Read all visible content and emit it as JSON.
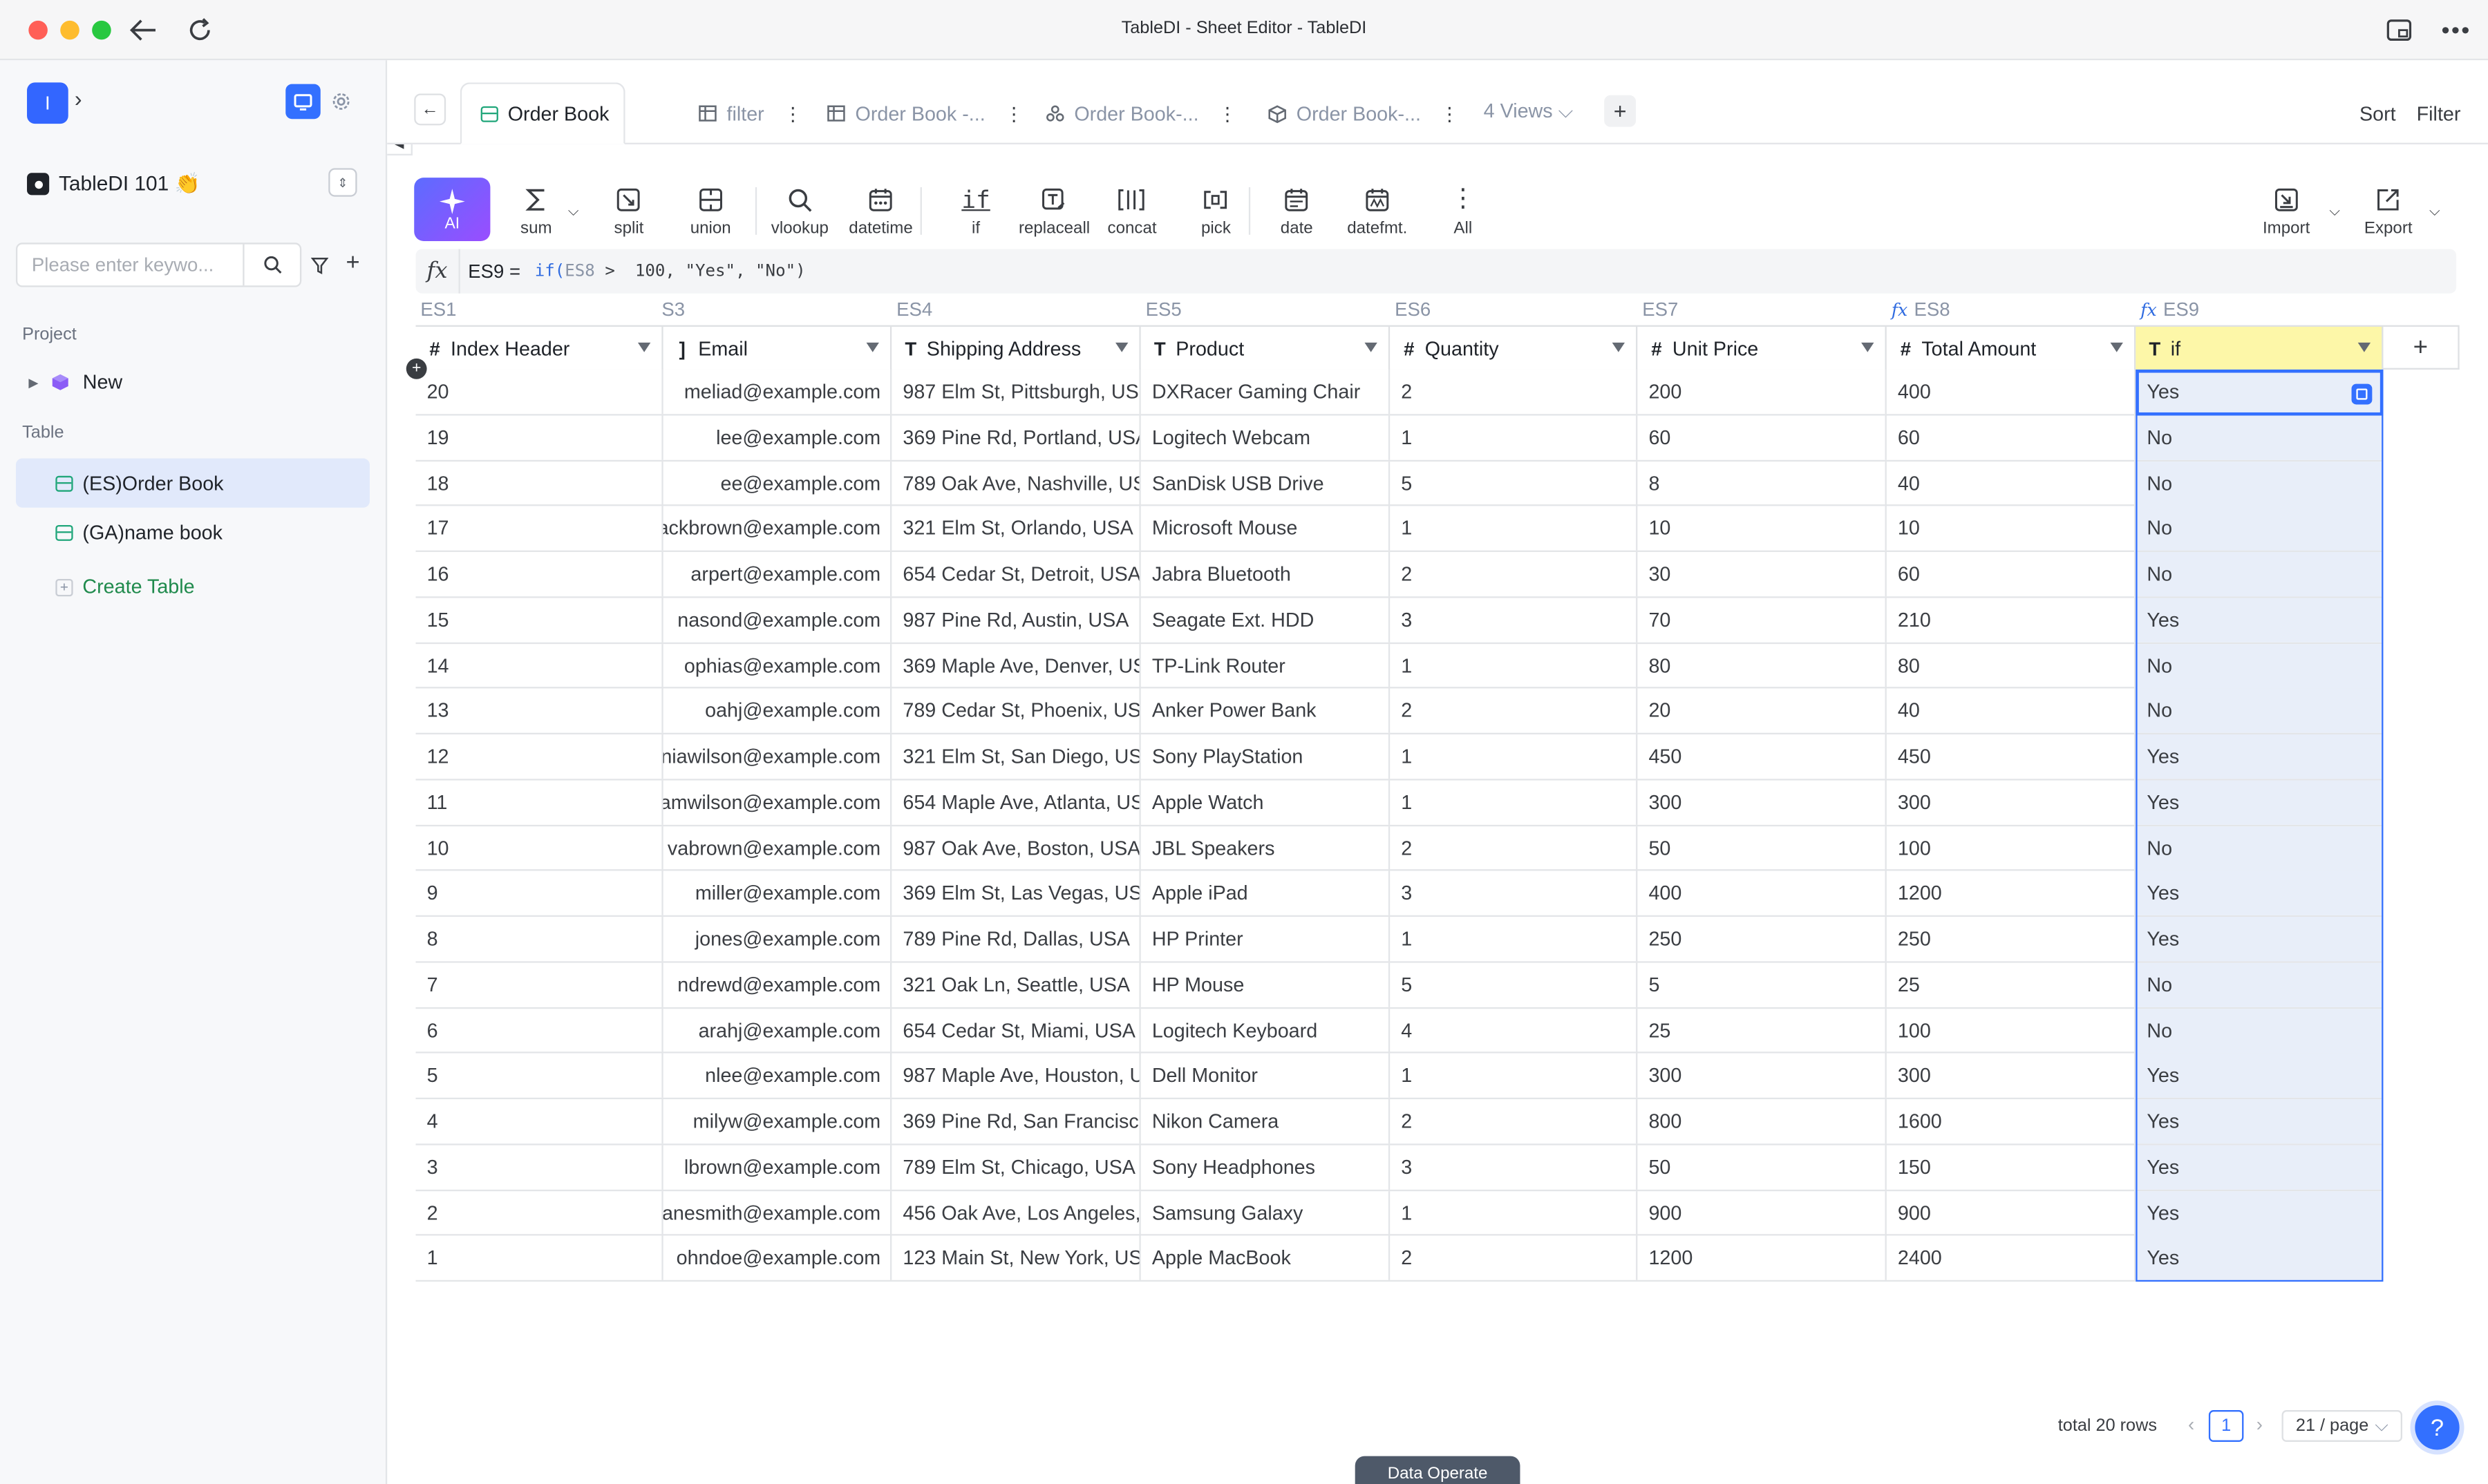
{
  "window": {
    "title": "TableDI - Sheet Editor - TableDI"
  },
  "sidebar": {
    "logo_letter": "I",
    "workspace": "TableDI 101 👏",
    "search_placeholder": "Please enter keywo...",
    "project_label": "Project",
    "project_item": "New",
    "table_label": "Table",
    "tables": [
      "(ES)Order Book",
      "(GA)name book"
    ],
    "create_table": "Create Table"
  },
  "tabs": {
    "active": "Order Book",
    "items": [
      "filter",
      "Order Book -...",
      "Order Book-...",
      "Order Book-..."
    ],
    "views": "4 Views",
    "sort": "Sort",
    "filter": "Filter"
  },
  "toolbar": {
    "ai": "AI",
    "tools": [
      "sum",
      "split",
      "union",
      "vlookup",
      "datetime",
      "if",
      "replaceall",
      "concat",
      "pick",
      "date",
      "datefmt.",
      "All"
    ],
    "import": "Import",
    "export": "Export"
  },
  "formula": {
    "cell": "ES9 =",
    "fn": "if(",
    "ref": "ES8",
    "rest": " >  100, \"Yes\", \"No\")"
  },
  "grid": {
    "column_ids": [
      "ES1",
      "S3",
      "ES4",
      "ES5",
      "ES6",
      "ES7",
      "ES8",
      "ES9"
    ],
    "headers": [
      "Index Header",
      "Email",
      "Shipping Address",
      "Product",
      "Quantity",
      "Unit Price",
      "Total Amount",
      "if"
    ],
    "header_type_icons": [
      "#",
      "]",
      "T",
      "T",
      "#",
      "#",
      "#",
      "T"
    ],
    "rows": [
      [
        "20",
        "meliad@example.com",
        "987 Elm St, Pittsburgh, US",
        "DXRacer Gaming Chair",
        "2",
        "200",
        "400",
        "Yes"
      ],
      [
        "19",
        "lee@example.com",
        "369 Pine Rd, Portland, USA",
        "Logitech Webcam",
        "1",
        "60",
        "60",
        "No"
      ],
      [
        "18",
        "ee@example.com",
        "789 Oak Ave, Nashville, US",
        "SanDisk USB Drive",
        "5",
        "8",
        "40",
        "No"
      ],
      [
        "17",
        "ackbrown@example.com",
        "321 Elm St, Orlando, USA",
        "Microsoft Mouse",
        "1",
        "10",
        "10",
        "No"
      ],
      [
        "16",
        "arpert@example.com",
        "654 Cedar St, Detroit, USA",
        "Jabra Bluetooth",
        "2",
        "30",
        "60",
        "No"
      ],
      [
        "15",
        "nasond@example.com",
        "987 Pine Rd, Austin, USA",
        "Seagate Ext. HDD",
        "3",
        "70",
        "210",
        "Yes"
      ],
      [
        "14",
        "ophias@example.com",
        "369 Maple Ave, Denver, US",
        "TP-Link Router",
        "1",
        "80",
        "80",
        "No"
      ],
      [
        "13",
        "oahj@example.com",
        "789 Cedar St, Phoenix, US",
        "Anker Power Bank",
        "2",
        "20",
        "40",
        "No"
      ],
      [
        "12",
        "niawilson@example.com",
        "321 Elm St, San Diego, US",
        "Sony PlayStation",
        "1",
        "450",
        "450",
        "Yes"
      ],
      [
        "11",
        "amwilson@example.com",
        "654 Maple Ave, Atlanta, US",
        "Apple Watch",
        "1",
        "300",
        "300",
        "Yes"
      ],
      [
        "10",
        "vabrown@example.com",
        "987 Oak Ave, Boston, USA",
        "JBL Speakers",
        "2",
        "50",
        "100",
        "No"
      ],
      [
        "9",
        "miller@example.com",
        "369 Elm St, Las Vegas, US",
        "Apple iPad",
        "3",
        "400",
        "1200",
        "Yes"
      ],
      [
        "8",
        "jones@example.com",
        "789 Pine Rd, Dallas, USA",
        "HP Printer",
        "1",
        "250",
        "250",
        "Yes"
      ],
      [
        "7",
        "ndrewd@example.com",
        "321 Oak Ln, Seattle, USA",
        "HP Mouse",
        "5",
        "5",
        "25",
        "No"
      ],
      [
        "6",
        "arahj@example.com",
        "654 Cedar St, Miami, USA",
        "Logitech Keyboard",
        "4",
        "25",
        "100",
        "No"
      ],
      [
        "5",
        "nlee@example.com",
        "987 Maple Ave, Houston, U",
        "Dell Monitor",
        "1",
        "300",
        "300",
        "Yes"
      ],
      [
        "4",
        "milyw@example.com",
        "369 Pine Rd, San Francisco",
        "Nikon Camera",
        "2",
        "800",
        "1600",
        "Yes"
      ],
      [
        "3",
        "lbrown@example.com",
        "789 Elm St, Chicago, USA",
        "Sony Headphones",
        "3",
        "50",
        "150",
        "Yes"
      ],
      [
        "2",
        "anesmith@example.com",
        "456 Oak Ave, Los Angeles,",
        "Samsung Galaxy",
        "1",
        "900",
        "900",
        "Yes"
      ],
      [
        "1",
        "ohndoe@example.com",
        "123 Main St, New York, US",
        "Apple MacBook",
        "2",
        "1200",
        "2400",
        "Yes"
      ]
    ]
  },
  "footer": {
    "total": "total 20 rows",
    "page": "1",
    "per_page": "21 / page",
    "help": "?",
    "data_operate": "Data Operate"
  },
  "colors": {
    "accent": "#3370ff",
    "selected_header": "#fdf7a8",
    "selected_column": "#e8eef9",
    "create_table": "#1f8a4c"
  }
}
